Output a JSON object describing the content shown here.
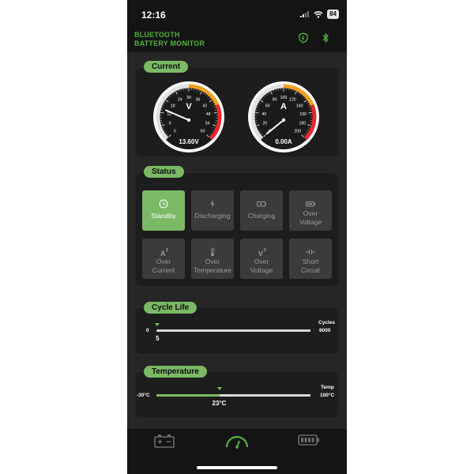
{
  "status_bar": {
    "time": "12:16",
    "battery_level": "84",
    "icons": [
      "signal-icon",
      "wifi-icon",
      "battery-icon"
    ]
  },
  "header": {
    "title_line1": "BLUETOOTH",
    "title_line2": "BATTERY MONITOR",
    "icons": [
      "shield-icon",
      "bluetooth-icon"
    ]
  },
  "current": {
    "label": "Current",
    "voltage": {
      "unit_symbol": "V",
      "ticks": [
        "0",
        "6",
        "12",
        "18",
        "24",
        "30",
        "36",
        "42",
        "48",
        "54",
        "60"
      ],
      "value": 13.6,
      "readout": "13.60V",
      "max": 60
    },
    "amperage": {
      "unit_symbol": "A",
      "ticks": [
        "0",
        "20",
        "40",
        "60",
        "80",
        "100",
        "120",
        "140",
        "160",
        "180",
        "200"
      ],
      "value": 0,
      "readout": "0.00A",
      "max": 200
    }
  },
  "status": {
    "label": "Status",
    "tiles": [
      {
        "label": "Standby",
        "icon": "clock-icon",
        "active": true
      },
      {
        "label": "Discharging",
        "icon": "lightning-icon",
        "active": false
      },
      {
        "label": "Charging",
        "icon": "battery-charging-icon",
        "active": false
      },
      {
        "label": "Over\nVoltage",
        "icon": "battery-full-icon",
        "active": false
      },
      {
        "label": "Over\nCurrent",
        "icon": "amp-up-icon",
        "active": false
      },
      {
        "label": "Over\nTemperature",
        "icon": "thermometer-icon",
        "active": false
      },
      {
        "label": "Over\nVoltage",
        "icon": "volt-up-icon",
        "active": false
      },
      {
        "label": "Short\nCircuit",
        "icon": "short-circuit-icon",
        "active": false
      }
    ]
  },
  "cycle_life": {
    "label": "Cycle Life",
    "min": "0",
    "max": "8000",
    "unit": "Cycles",
    "value": "5",
    "fraction": 0.006
  },
  "temperature": {
    "label": "Temperature",
    "min": "-30°C",
    "max": "100°C",
    "unit": "Temp",
    "value": "23°C",
    "fraction": 0.408
  },
  "tabbar": {
    "tabs": [
      {
        "name": "battery-tab",
        "icon": "car-battery-icon",
        "active": false
      },
      {
        "name": "gauge-tab",
        "icon": "gauge-icon",
        "active": true
      },
      {
        "name": "capacity-tab",
        "icon": "battery-level-icon",
        "active": false
      }
    ]
  },
  "colors": {
    "accent_green": "#7bb965",
    "title_green": "#4fb33b",
    "gauge_orange": "#f0a020",
    "gauge_red": "#e8282d"
  }
}
